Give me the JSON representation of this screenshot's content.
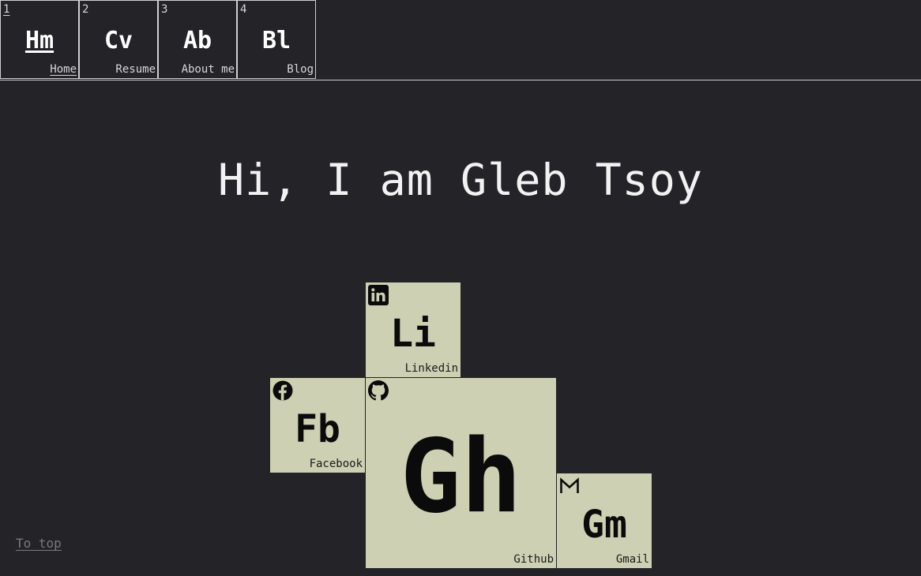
{
  "nav": {
    "items": [
      {
        "number": "1",
        "symbol": "Hm",
        "name": "Home",
        "active": true
      },
      {
        "number": "2",
        "symbol": "Cv",
        "name": "Resume",
        "active": false
      },
      {
        "number": "3",
        "symbol": "Ab",
        "name": "About me",
        "active": false
      },
      {
        "number": "4",
        "symbol": "Bl",
        "name": "Blog",
        "active": false
      }
    ]
  },
  "hero": {
    "greeting": "Hi, I am Gleb Tsoy"
  },
  "social": {
    "linkedin": {
      "symbol": "Li",
      "name": "Linkedin",
      "icon": "linkedin-icon"
    },
    "facebook": {
      "symbol": "Fb",
      "name": "Facebook",
      "icon": "facebook-icon"
    },
    "github": {
      "symbol": "Gh",
      "name": "Github",
      "icon": "github-icon"
    },
    "gmail": {
      "symbol": "Gm",
      "name": "Gmail",
      "icon": "gmail-icon"
    }
  },
  "footer": {
    "to_top": "To top"
  },
  "colors": {
    "background": "#232328",
    "tile": "#cdd0b3",
    "text": "#ececec",
    "muted": "#7a7a7e"
  }
}
